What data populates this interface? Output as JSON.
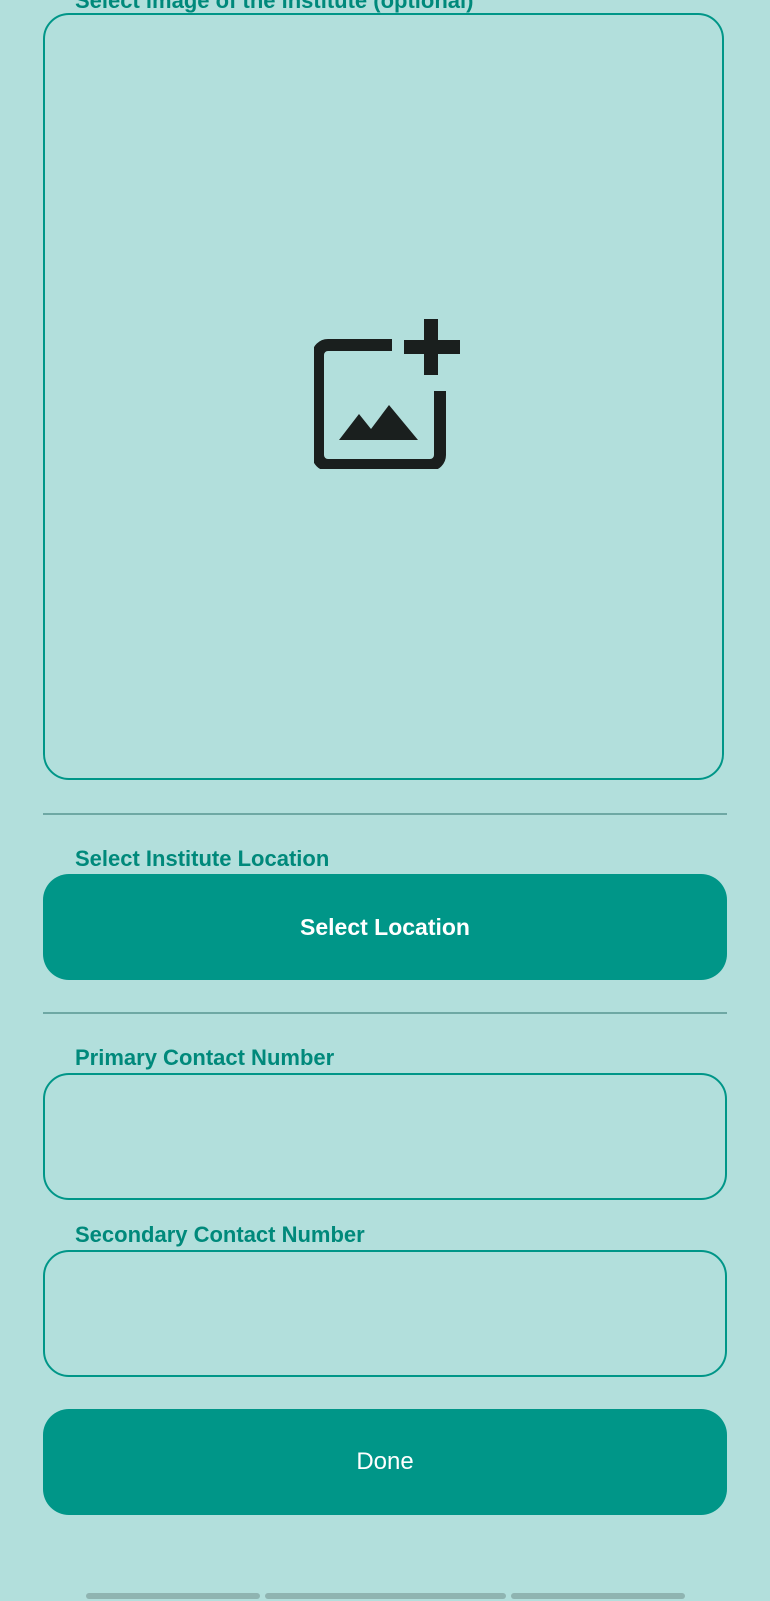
{
  "image_section": {
    "label": "Select image of the institute (optional)",
    "icon": "add-photo-icon"
  },
  "location_section": {
    "label": "Select Institute Location",
    "button_label": "Select Location"
  },
  "primary_contact": {
    "label": "Primary Contact Number",
    "value": "",
    "placeholder": ""
  },
  "secondary_contact": {
    "label": "Secondary Contact Number",
    "value": "",
    "placeholder": ""
  },
  "done_button": {
    "label": "Done"
  },
  "colors": {
    "background": "#b2dfdc",
    "accent": "#009688",
    "label": "#00897b",
    "icon": "#1a1f1e"
  }
}
